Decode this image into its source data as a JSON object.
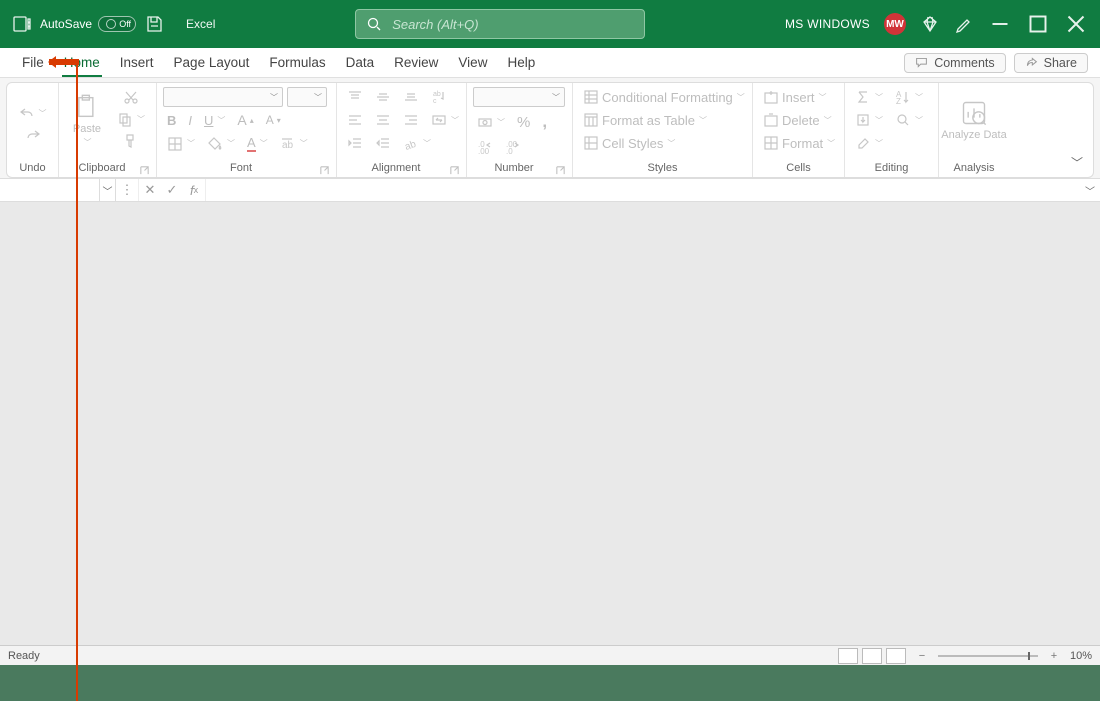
{
  "titlebar": {
    "autosave_label": "AutoSave",
    "autosave_state": "Off",
    "app_name": "Excel",
    "search_placeholder": "Search (Alt+Q)",
    "user_name": "MS WINDOWS",
    "avatar_initials": "MW"
  },
  "tabs": {
    "file": "File",
    "home": "Home",
    "insert": "Insert",
    "page_layout": "Page Layout",
    "formulas": "Formulas",
    "data": "Data",
    "review": "Review",
    "view": "View",
    "help": "Help",
    "comments": "Comments",
    "share": "Share"
  },
  "ribbon": {
    "undo_group": "Undo",
    "clipboard_group": "Clipboard",
    "paste": "Paste",
    "font_group": "Font",
    "alignment_group": "Alignment",
    "number_group": "Number",
    "styles_group": "Styles",
    "cond_fmt": "Conditional Formatting",
    "fmt_table": "Format as Table",
    "cell_styles": "Cell Styles",
    "cells_group": "Cells",
    "insert_btn": "Insert",
    "delete_btn": "Delete",
    "format_btn": "Format",
    "editing_group": "Editing",
    "analysis_group": "Analysis",
    "analyze_data": "Analyze Data"
  },
  "statusbar": {
    "ready": "Ready",
    "zoom": "10%"
  }
}
